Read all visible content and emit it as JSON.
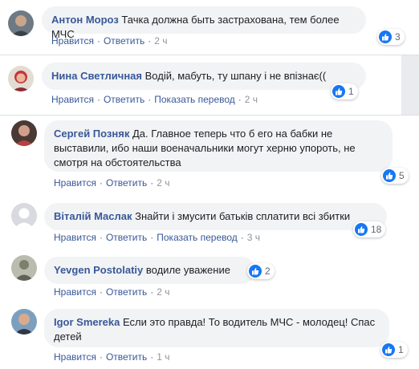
{
  "colors": {
    "name": "#385898",
    "bubble": "#f2f3f5",
    "like_blue": "#1877f2",
    "meta": "#606770"
  },
  "actions": {
    "like": "Нравится",
    "reply": "Ответить",
    "translate": "Показать перевод"
  },
  "comments": [
    {
      "author": "Антон Мороз",
      "text": "Тачка должна быть застрахована, тем более МЧС",
      "time": "2 ч",
      "likes": "3",
      "avatar_icon": "user-avatar-icon"
    },
    {
      "author": "Нина Светличная",
      "text": "Водій, мабуть, ту шпану і не впізнає((",
      "time": "2 ч",
      "likes": "1",
      "avatar_icon": "user-avatar-icon"
    },
    {
      "author": "Сергей Позняк",
      "text": "Да. Главное теперь что б его на бабки не выставили, ибо наши военачальники могут херню упороть, не смотря на обстоятельства",
      "time": "2 ч",
      "likes": "5",
      "avatar_icon": "user-avatar-icon"
    },
    {
      "author": "Віталій Маслак",
      "text": "Знайти і змусити батьків сплатити всі збитки",
      "time": "3 ч",
      "likes": "18",
      "avatar_icon": "default-avatar-icon"
    },
    {
      "author": "Yevgen Postolatiy",
      "text": "водиле уважение",
      "time": "2 ч",
      "likes": "2",
      "avatar_icon": "user-avatar-icon"
    },
    {
      "author": "Igor Smereka",
      "text": "Если это правда! То водитель МЧС - молодец! Спас детей",
      "time": "1 ч",
      "likes": "1",
      "avatar_icon": "user-avatar-icon"
    }
  ]
}
